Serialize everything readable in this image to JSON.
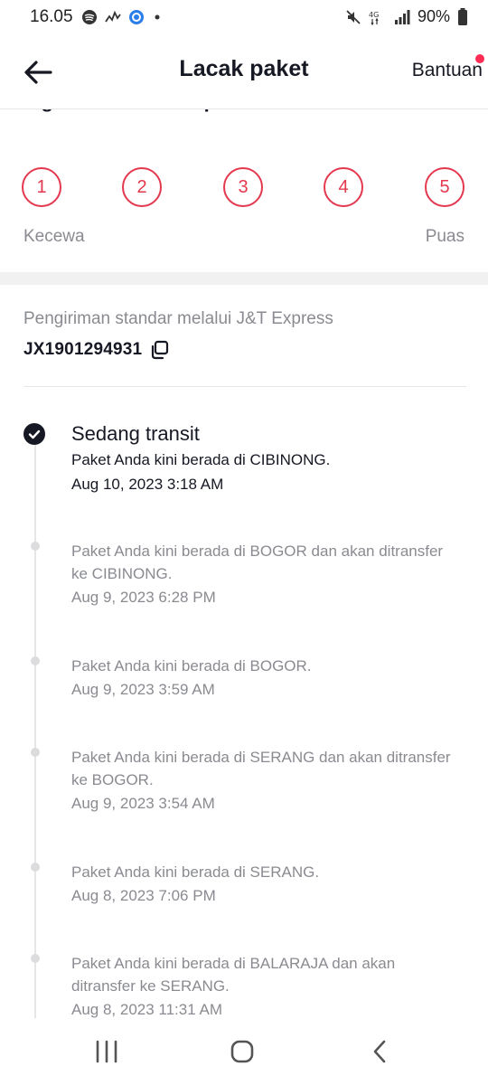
{
  "status_bar": {
    "time": "16.05",
    "battery": "90%",
    "network": "4G"
  },
  "header": {
    "title": "Lacak paket",
    "help": "Bantuan"
  },
  "rating": {
    "question": "logistik TikTok Shop?",
    "scores": [
      "1",
      "2",
      "3",
      "4",
      "5"
    ],
    "low_label": "Kecewa",
    "high_label": "Puas"
  },
  "shipment": {
    "method": "Pengiriman standar melalui J&T Express",
    "tracking_number": "JX1901294931"
  },
  "timeline": [
    {
      "status": "Sedang transit",
      "description": "Paket Anda kini berada di CIBINONG.",
      "time": "Aug 10, 2023 3:18 AM"
    },
    {
      "description": "Paket Anda kini berada di BOGOR dan akan ditransfer ke CIBINONG.",
      "time": "Aug 9, 2023 6:28 PM"
    },
    {
      "description": "Paket Anda kini berada di BOGOR.",
      "time": "Aug 9, 2023 3:59 AM"
    },
    {
      "description": "Paket Anda kini berada di SERANG dan akan ditransfer ke BOGOR.",
      "time": "Aug 9, 2023 3:54 AM"
    },
    {
      "description": "Paket Anda kini berada di SERANG.",
      "time": "Aug 8, 2023 7:06 PM"
    },
    {
      "description": "Paket Anda kini berada di BALARAJA dan akan ditransfer ke SERANG.",
      "time": "Aug 8, 2023 11:31 AM"
    }
  ],
  "colors": {
    "accent": "#e4384f",
    "notification_dot": "#fe2c55",
    "text_primary": "#161823",
    "text_secondary": "#8a8b91"
  }
}
